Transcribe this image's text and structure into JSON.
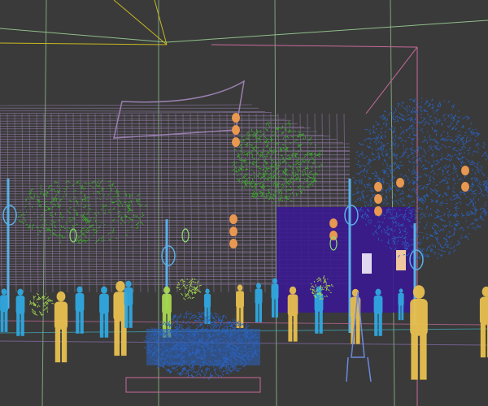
{
  "viewport": {
    "background": "#3a3a3a",
    "colors": {
      "grid_green": "#8fbf8a",
      "camera_yellow": "#c8b820",
      "box_pink": "#c86a9a",
      "building_purple": "#9a7fb0",
      "tree_green": "#3ca82c",
      "tree_blue": "#2a62c0",
      "block_indigo": "#3a1a90",
      "lantern_orange": "#e89850",
      "person_yellow": "#e8c050",
      "person_cyan": "#30a8e0",
      "person_lime": "#a8d850"
    }
  }
}
